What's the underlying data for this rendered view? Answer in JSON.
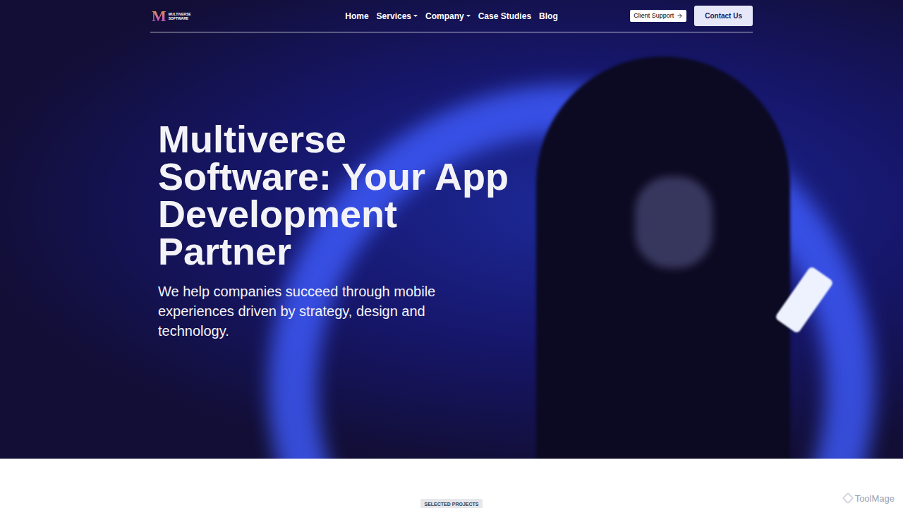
{
  "logo": {
    "mark": "M",
    "name_line1": "MULTIVERSE",
    "name_line2": "SOFTWARE"
  },
  "nav": [
    {
      "label": "Home",
      "dropdown": false
    },
    {
      "label": "Services",
      "dropdown": true
    },
    {
      "label": "Company",
      "dropdown": true
    },
    {
      "label": "Case Studies",
      "dropdown": false
    },
    {
      "label": "Blog",
      "dropdown": false
    }
  ],
  "client_support": {
    "label": "Client Support"
  },
  "contact_button": {
    "label": "Contact Us"
  },
  "hero": {
    "title_lines": [
      "Multiverse",
      "Software: Your App",
      "Development",
      "Partner"
    ],
    "subtitle_lines": [
      "We help companies succeed through mobile",
      "experiences driven by strategy, design and",
      "technology."
    ]
  },
  "section_badge": "SELECTED PROJECTS",
  "watermark": "ToolMage"
}
